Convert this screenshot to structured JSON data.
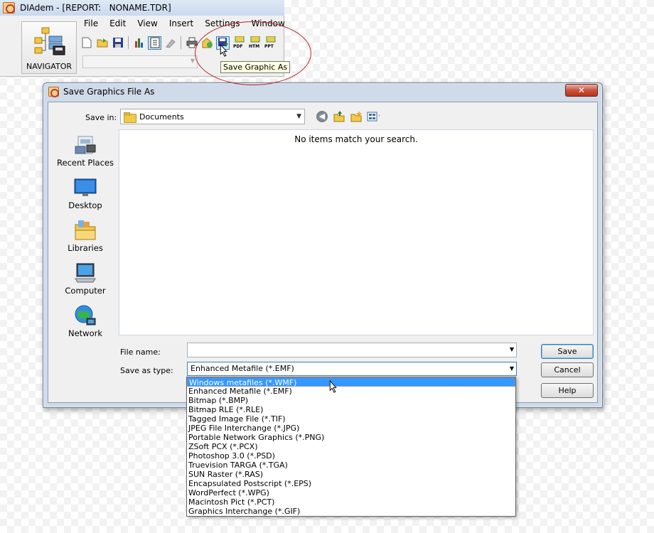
{
  "app": {
    "title": "DIAdem - [REPORT:   NONAME.TDR]",
    "navigator_label": "NAVIGATOR",
    "menu": [
      "File",
      "Edit",
      "View",
      "Insert",
      "Settings",
      "Window"
    ],
    "toolbar": {
      "icons": [
        "new-icon",
        "open-icon",
        "save-icon",
        "chart-icon",
        "report-icon",
        "format-icon",
        "print-icon",
        "export-icon",
        "save-graphic-icon",
        "pdf-icon",
        "htm-icon",
        "ppt-icon"
      ],
      "pdf_label": "PDF",
      "htm_label": "HTM",
      "ppt_label": "PPT"
    },
    "tooltip": "Save Graphic As",
    "highlight_color": "#b8232a"
  },
  "dialog": {
    "title": "Save Graphics File As",
    "close_label": "✕",
    "save_in_label": "Save in:",
    "save_in_value": "Documents",
    "empty_message": "No items match your search.",
    "places": [
      "Recent Places",
      "Desktop",
      "Libraries",
      "Computer",
      "Network"
    ],
    "file_name_label": "File name:",
    "file_name_value": "",
    "save_as_type_label": "Save as type:",
    "save_as_type_value": "Enhanced Metafile (*.EMF)",
    "buttons": {
      "save": "Save",
      "cancel": "Cancel",
      "help": "Help"
    },
    "type_options": [
      "Windows metafiles (*.WMF)",
      "Enhanced Metafile (*.EMF)",
      "Bitmap (*.BMP)",
      "Bitmap RLE (*.RLE)",
      "Tagged Image File (*.TIF)",
      "JPEG File Interchange (*.JPG)",
      "Portable Network Graphics (*.PNG)",
      "ZSoft PCX (*.PCX)",
      "Photoshop 3.0 (*.PSD)",
      "Truevision TARGA (*.TGA)",
      "SUN Raster (*.RAS)",
      "Encapsulated Postscript (*.EPS)",
      "WordPerfect (*.WPG)",
      "Macintosh Pict (*.PCT)",
      "Graphics Interchange (*.GIF)"
    ],
    "selected_option_index": 0,
    "selection_color": "#3399ff"
  }
}
